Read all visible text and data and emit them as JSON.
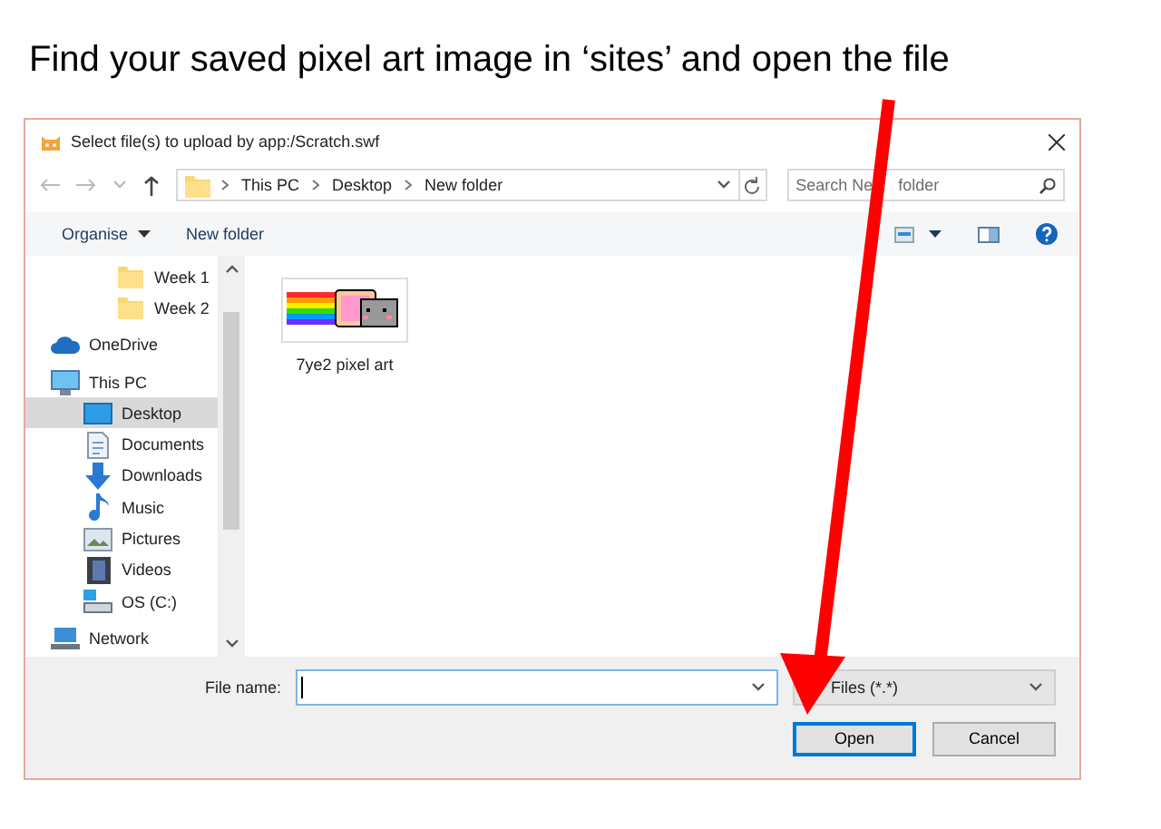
{
  "instruction": "Find your saved pixel art image in ‘sites’ and open the file",
  "dialog": {
    "title": "Select file(s) to upload by app:/Scratch.swf",
    "breadcrumbs": [
      "This PC",
      "Desktop",
      "New folder"
    ],
    "search": {
      "placeholder_parts": [
        "Search Ne",
        "folder"
      ]
    },
    "toolbar": [
      "Organise",
      "New folder"
    ],
    "nav_pane": {
      "scrolled_children": [
        {
          "label": "Week 1",
          "kind": "folder",
          "selected": false
        },
        {
          "label": "Week 2",
          "kind": "folder",
          "selected": false
        }
      ],
      "items": [
        {
          "label": "OneDrive",
          "kind": "cloud",
          "selected": false
        },
        {
          "label": "This PC",
          "kind": "computer",
          "selected": false,
          "children": [
            {
              "label": "Desktop",
              "kind": "desktop",
              "selected": true
            },
            {
              "label": "Documents",
              "kind": "documents",
              "selected": false
            },
            {
              "label": "Downloads",
              "kind": "downloads",
              "selected": false
            },
            {
              "label": "Music",
              "kind": "music",
              "selected": false
            },
            {
              "label": "Pictures",
              "kind": "pictures",
              "selected": false
            },
            {
              "label": "Videos",
              "kind": "videos",
              "selected": false
            },
            {
              "label": "OS (C:)",
              "kind": "drive",
              "selected": false
            }
          ]
        },
        {
          "label": "Network",
          "kind": "network",
          "selected": false
        }
      ]
    },
    "files": [
      {
        "name": "7ye2 pixel art",
        "selected": false
      }
    ],
    "file_name": {
      "label": "File name:"
    },
    "file_type": "Files (*.*)",
    "buttons": [
      "Open",
      "Cancel"
    ]
  }
}
